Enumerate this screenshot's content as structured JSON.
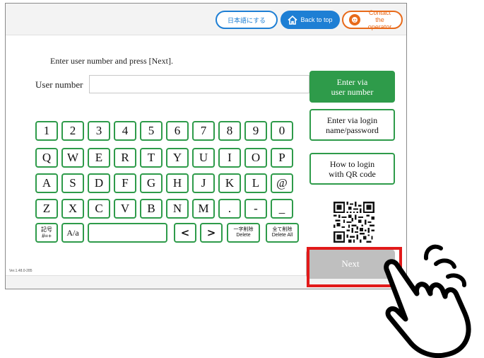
{
  "header": {
    "language_label": "日本語にする",
    "back_label": "Back to top",
    "operator_label_line1": "Contact the",
    "operator_label_line2": "operator"
  },
  "form": {
    "instruction": "Enter user number and press [Next].",
    "user_number_label": "User number",
    "user_number_value": ""
  },
  "keyboard": {
    "row1": [
      "1",
      "2",
      "3",
      "4",
      "5",
      "6",
      "7",
      "8",
      "9",
      "0"
    ],
    "row2": [
      "Q",
      "W",
      "E",
      "R",
      "T",
      "Y",
      "U",
      "I",
      "O",
      "P"
    ],
    "row3": [
      "A",
      "S",
      "D",
      "F",
      "G",
      "H",
      "J",
      "K",
      "L",
      "@"
    ],
    "row4": [
      "Z",
      "X",
      "C",
      "V",
      "B",
      "N",
      "M",
      ".",
      "-",
      "_"
    ],
    "symbols_top": "記号",
    "symbols_bottom": "#=+",
    "case_label": "A/a",
    "delete_jp": "一字削除",
    "delete_en": "Delete",
    "delete_all_jp": "全て削除",
    "delete_all_en": "Delete All",
    "left_arrow": "<",
    "right_arrow": ">"
  },
  "side": {
    "user_number_line1": "Enter via",
    "user_number_line2": "user number",
    "login_line1": "Enter via login",
    "login_line2": "name/password",
    "qr_line1": "How to login",
    "qr_line2": "with QR code"
  },
  "footer": {
    "version": "Ver.1.48.0-285",
    "next_label": "Next"
  },
  "colors": {
    "accent_green": "#2e9b4a",
    "accent_blue": "#1e7fd4",
    "accent_orange": "#e86a1a",
    "highlight_red": "#e21a1a"
  }
}
